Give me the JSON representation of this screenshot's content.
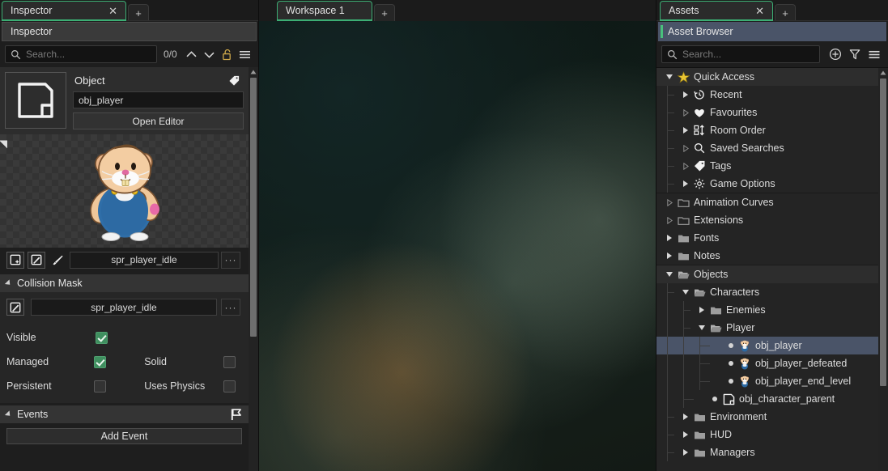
{
  "left_panel": {
    "tab": {
      "label": "Inspector",
      "close": "✕",
      "add": "+"
    },
    "header": "Inspector",
    "search": {
      "placeholder": "Search...",
      "value": "",
      "count": "0/0"
    },
    "object": {
      "section_label": "Object",
      "name_value": "obj_player",
      "open_editor_label": "Open Editor",
      "tag_icon": "tag-icon"
    },
    "sprite": {
      "name": "spr_player_idle",
      "menu_label": "···"
    },
    "collision_mask": {
      "section_label": "Collision Mask",
      "mask_sprite": "spr_player_idle",
      "menu_label": "···"
    },
    "properties": [
      {
        "label": "Visible",
        "checked": true,
        "label2": "",
        "checked2": null
      },
      {
        "label": "Managed",
        "checked": true,
        "label2": "Solid",
        "checked2": false
      },
      {
        "label": "Persistent",
        "checked": false,
        "label2": "Uses Physics",
        "checked2": false
      }
    ],
    "events": {
      "section_label": "Events",
      "flag_icon": "flag-icon",
      "add_event_label": "Add Event"
    }
  },
  "center_panel": {
    "tab": {
      "label": "Workspace 1",
      "add": "+"
    }
  },
  "right_panel": {
    "tab": {
      "label": "Assets",
      "close": "✕",
      "add": "+"
    },
    "header": "Asset Browser",
    "search": {
      "placeholder": "Search...",
      "value": ""
    },
    "toolbar": {
      "add": "add-circle-icon",
      "filter": "filter-icon",
      "menu": "hamburger-menu-icon"
    },
    "tree": [
      {
        "label": "Quick Access",
        "depth": 0,
        "arrow": "down",
        "icon": "star-icon",
        "selected": false,
        "highlight": true
      },
      {
        "label": "Recent",
        "depth": 1,
        "arrow": "filled",
        "icon": "history-icon",
        "selected": false
      },
      {
        "label": "Favourites",
        "depth": 1,
        "arrow": "hollow",
        "icon": "heart-icon",
        "selected": false
      },
      {
        "label": "Room Order",
        "depth": 1,
        "arrow": "filled",
        "icon": "room-order-icon",
        "selected": false
      },
      {
        "label": "Saved Searches",
        "depth": 1,
        "arrow": "hollow",
        "icon": "search-icon",
        "selected": false
      },
      {
        "label": "Tags",
        "depth": 1,
        "arrow": "hollow",
        "icon": "tag-icon",
        "selected": false
      },
      {
        "label": "Game Options",
        "depth": 1,
        "arrow": "filled",
        "icon": "gear-icon",
        "selected": false
      },
      {
        "label": "Animation Curves",
        "depth": 0,
        "arrow": "hollow",
        "icon": "folder-empty-icon",
        "selected": false
      },
      {
        "label": "Extensions",
        "depth": 0,
        "arrow": "hollow",
        "icon": "folder-empty-icon",
        "selected": false
      },
      {
        "label": "Fonts",
        "depth": 0,
        "arrow": "filled",
        "icon": "folder-icon",
        "selected": false
      },
      {
        "label": "Notes",
        "depth": 0,
        "arrow": "filled",
        "icon": "folder-icon",
        "selected": false
      },
      {
        "label": "Objects",
        "depth": 0,
        "arrow": "down",
        "icon": "folder-open-icon",
        "selected": false,
        "highlight": true
      },
      {
        "label": "Characters",
        "depth": 1,
        "arrow": "down",
        "icon": "folder-open-icon",
        "selected": false
      },
      {
        "label": "Enemies",
        "depth": 2,
        "arrow": "filled",
        "icon": "folder-icon",
        "selected": false
      },
      {
        "label": "Player",
        "depth": 2,
        "arrow": "down",
        "icon": "folder-open-icon",
        "selected": false
      },
      {
        "label": "obj_player",
        "depth": 3,
        "arrow": "none",
        "icon": "object-sprite-icon",
        "bullet": true,
        "selected": true
      },
      {
        "label": "obj_player_defeated",
        "depth": 3,
        "arrow": "none",
        "icon": "object-sprite-icon",
        "bullet": true,
        "selected": false
      },
      {
        "label": "obj_player_end_level",
        "depth": 3,
        "arrow": "none",
        "icon": "object-sprite-icon",
        "bullet": true,
        "selected": false
      },
      {
        "label": "obj_character_parent",
        "depth": 2,
        "arrow": "none",
        "icon": "object-blank-icon",
        "bullet": true,
        "selected": false
      },
      {
        "label": "Environment",
        "depth": 1,
        "arrow": "filled",
        "icon": "folder-icon",
        "selected": false
      },
      {
        "label": "HUD",
        "depth": 1,
        "arrow": "filled",
        "icon": "folder-icon",
        "selected": false
      },
      {
        "label": "Managers",
        "depth": 1,
        "arrow": "filled",
        "icon": "folder-icon",
        "selected": false
      }
    ]
  },
  "colors": {
    "accent_green": "#3cae74",
    "selection_blue": "#4a5468",
    "panel_bg": "#1e1e1e",
    "tree_bg": "#242424",
    "check_green": "#3f8f5f",
    "star_yellow": "#e8c432"
  }
}
